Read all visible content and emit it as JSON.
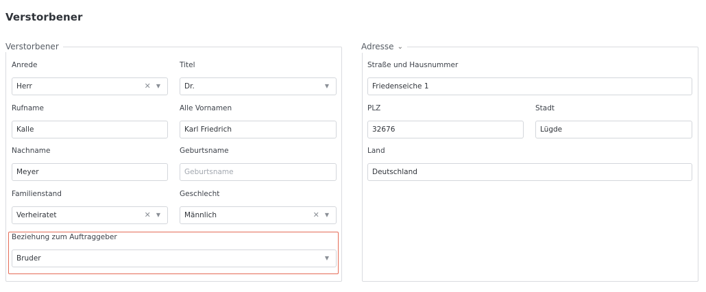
{
  "page": {
    "title": "Verstorbener"
  },
  "deceased_section": {
    "legend": "Verstorbener",
    "fields": {
      "salutation": {
        "label": "Anrede",
        "value": "Herr"
      },
      "title": {
        "label": "Titel",
        "value": "Dr."
      },
      "first_name": {
        "label": "Rufname",
        "value": "Kalle"
      },
      "all_first_names": {
        "label": "Alle Vornamen",
        "value": "Karl Friedrich"
      },
      "last_name": {
        "label": "Nachname",
        "value": "Meyer"
      },
      "birth_name": {
        "label": "Geburtsname",
        "value": "",
        "placeholder": "Geburtsname"
      },
      "marital_status": {
        "label": "Familienstand",
        "value": "Verheiratet"
      },
      "gender": {
        "label": "Geschlecht",
        "value": "Männlich"
      },
      "relationship": {
        "label": "Beziehung zum Auftraggeber",
        "value": "Bruder"
      }
    }
  },
  "address_section": {
    "legend": "Adresse",
    "fields": {
      "street": {
        "label": "Straße und Hausnummer",
        "value": "Friedenseiche 1"
      },
      "zip": {
        "label": "PLZ",
        "value": "32676"
      },
      "city": {
        "label": "Stadt",
        "value": "Lügde"
      },
      "country": {
        "label": "Land",
        "value": "Deutschland"
      }
    }
  },
  "icons": {
    "clear": "clear-x-icon",
    "dropdown": "caret-down-icon",
    "legend_toggle": "chevron-down-icon"
  },
  "colors": {
    "highlight_border": "#e46a55",
    "border": "#d3d6db",
    "title": "#2f3339"
  }
}
